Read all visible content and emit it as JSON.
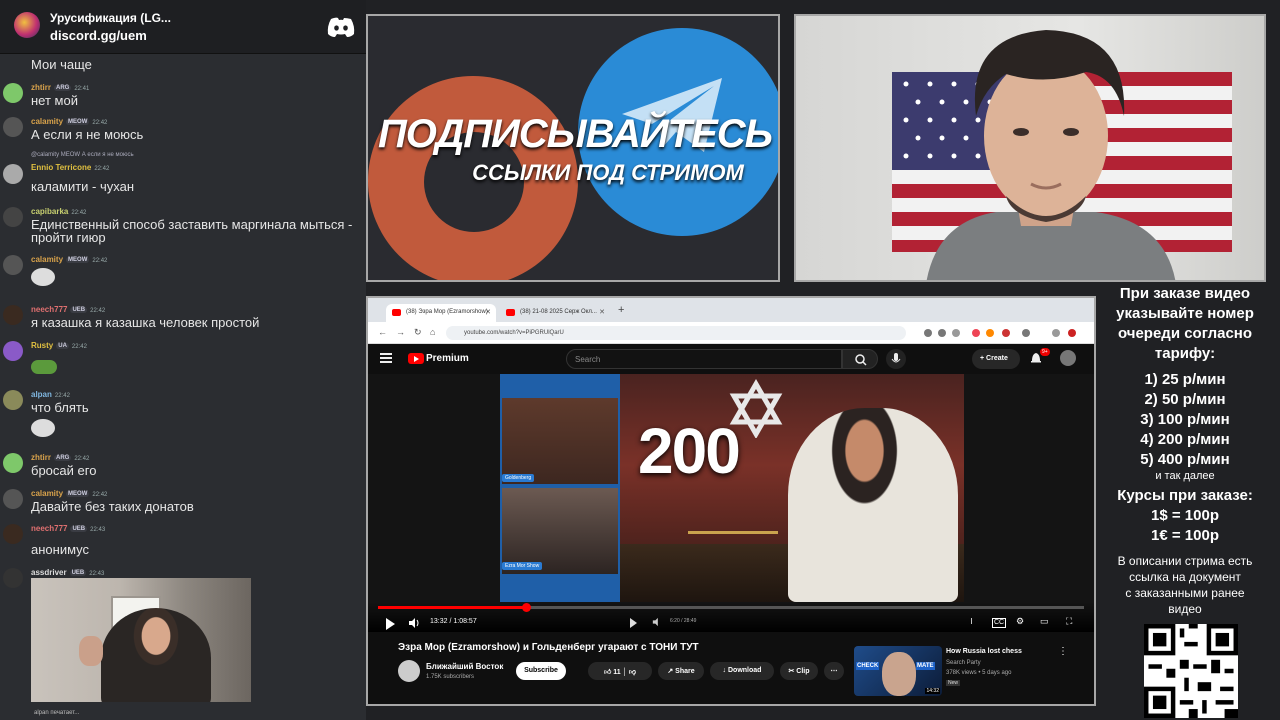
{
  "discord": {
    "server_name": "Урусификация (LG...",
    "server_link": "discord.gg/uem",
    "typing": "alpan печатает...",
    "messages": [
      {
        "text": "Мои чаще"
      },
      {
        "user": "zhtirr",
        "badge": "ARG",
        "time": "22:41",
        "text": "нет мой",
        "color": "#d8a24b"
      },
      {
        "user": "calamity",
        "badge": "MEOW",
        "time": "22:42",
        "text": "А если я не моюсь",
        "color": "#d8a24b"
      },
      {
        "reply": "@calamity MEOW А если я не моюсь",
        "user": "Ennio Terricone",
        "time": "22:42",
        "text": "каламити - чухан",
        "color": "#e0c040"
      },
      {
        "user": "capibarka",
        "time": "22:42",
        "text": "Единственный способ заставить маргинала мыться - пройти гиюр",
        "color": "#c8d070"
      },
      {
        "user": "calamity",
        "badge": "MEOW",
        "time": "22:42",
        "color": "#d8a24b"
      },
      {
        "user": "neech777",
        "badge": "UEB",
        "time": "22:42",
        "text": "я казашка я казашка человек простой",
        "color": "#e07070"
      },
      {
        "user": "Rusty",
        "badge": "UA",
        "time": "22:42",
        "color": "#e0c040"
      },
      {
        "user": "alpan",
        "time": "22:42",
        "text": "что блять",
        "color": "#7fb6e0"
      },
      {
        "user": "zhtirr",
        "badge": "ARG",
        "time": "22:42",
        "text": "бросай его",
        "color": "#d8a24b"
      },
      {
        "user": "calamity",
        "badge": "MEOW",
        "time": "22:42",
        "text": "Давайте без таких донатов",
        "color": "#d8a24b"
      },
      {
        "user": "neech777",
        "badge": "UEB",
        "time": "22:43",
        "text": "анонимус",
        "color": "#e07070"
      },
      {
        "user": "assdriver",
        "badge": "UEB",
        "time": "22:43",
        "color": "#dddddd"
      }
    ]
  },
  "promo": {
    "title": "ПОДПИСЫВАЙТЕСЬ",
    "subtitle": "ССЫЛКИ ПОД СТРИМОМ"
  },
  "browser": {
    "tabs": [
      "(38) Эзра Мор (Ezramorshow)",
      "(38) 21-08 2025 Серж Окл..."
    ],
    "url": "youtube.com/watch?v=PiPGRUlQarU",
    "yt_brand": "Premium",
    "search_placeholder": "Search",
    "create_label": "Create",
    "notif_count": "9+",
    "overlay_number": "200",
    "left_labels": [
      "Goldenberg",
      "Ezra Mor Show"
    ],
    "timecode": "13:32 / 1:08:57",
    "inner_timecode": "6:20 / 28:49",
    "progress": 0.21,
    "video_title": "Эзра Мор (Ezramorshow) и Гольденберг угарают с ТОНИ ТУТ",
    "channel": "Ближайший Восток",
    "subscribers": "1.75K subscribers",
    "subscribe_label": "Subscribe",
    "likes": "11",
    "share_label": "Share",
    "download_label": "Download",
    "clip_label": "Clip",
    "rec": {
      "title": "How Russia lost chess",
      "channel": "Search Party",
      "views": "378K views • 5 days ago",
      "badge": "New",
      "thumb_a": "CHECK",
      "thumb_b": "MATE",
      "duration": "14:32"
    }
  },
  "info": {
    "lines": [
      "При заказе видео",
      "указывайте номер",
      "очереди согласно",
      "тарифу:"
    ],
    "tariffs": [
      "1) 25 р/мин",
      "2) 50 р/мин",
      "3) 100 р/мин",
      "4) 200 р/мин",
      "5) 400 р/мин"
    ],
    "more": "и так далее",
    "courses_title": "Курсы при заказе:",
    "courses": [
      "1$ = 100р",
      "1€ = 100р"
    ],
    "desc": [
      "В описании стрима есть",
      "ссылка на документ",
      "с заказанными ранее",
      "видео"
    ]
  }
}
